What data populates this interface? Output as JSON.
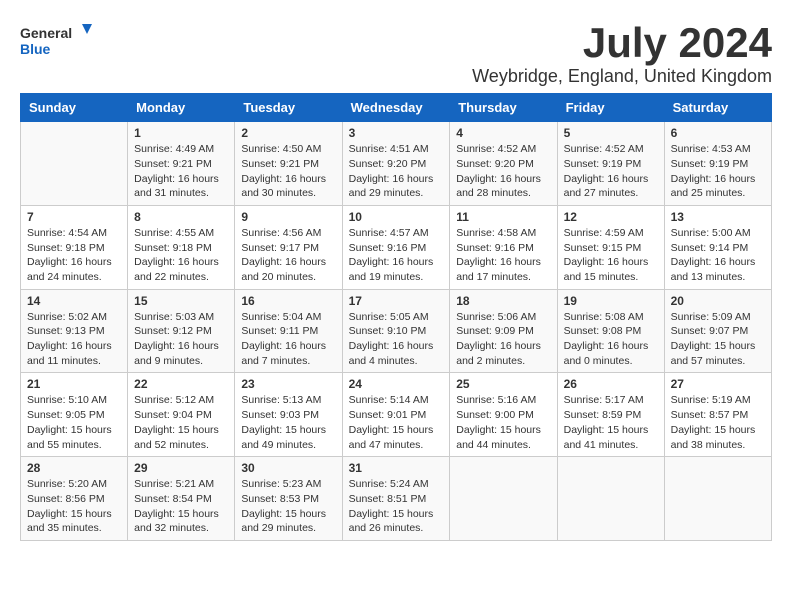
{
  "header": {
    "logo_general": "General",
    "logo_blue": "Blue",
    "title": "July 2024",
    "subtitle": "Weybridge, England, United Kingdom"
  },
  "columns": [
    "Sunday",
    "Monday",
    "Tuesday",
    "Wednesday",
    "Thursday",
    "Friday",
    "Saturday"
  ],
  "weeks": [
    {
      "days": [
        {
          "number": "",
          "info": ""
        },
        {
          "number": "1",
          "info": "Sunrise: 4:49 AM\nSunset: 9:21 PM\nDaylight: 16 hours\nand 31 minutes."
        },
        {
          "number": "2",
          "info": "Sunrise: 4:50 AM\nSunset: 9:21 PM\nDaylight: 16 hours\nand 30 minutes."
        },
        {
          "number": "3",
          "info": "Sunrise: 4:51 AM\nSunset: 9:20 PM\nDaylight: 16 hours\nand 29 minutes."
        },
        {
          "number": "4",
          "info": "Sunrise: 4:52 AM\nSunset: 9:20 PM\nDaylight: 16 hours\nand 28 minutes."
        },
        {
          "number": "5",
          "info": "Sunrise: 4:52 AM\nSunset: 9:19 PM\nDaylight: 16 hours\nand 27 minutes."
        },
        {
          "number": "6",
          "info": "Sunrise: 4:53 AM\nSunset: 9:19 PM\nDaylight: 16 hours\nand 25 minutes."
        }
      ]
    },
    {
      "days": [
        {
          "number": "7",
          "info": "Sunrise: 4:54 AM\nSunset: 9:18 PM\nDaylight: 16 hours\nand 24 minutes."
        },
        {
          "number": "8",
          "info": "Sunrise: 4:55 AM\nSunset: 9:18 PM\nDaylight: 16 hours\nand 22 minutes."
        },
        {
          "number": "9",
          "info": "Sunrise: 4:56 AM\nSunset: 9:17 PM\nDaylight: 16 hours\nand 20 minutes."
        },
        {
          "number": "10",
          "info": "Sunrise: 4:57 AM\nSunset: 9:16 PM\nDaylight: 16 hours\nand 19 minutes."
        },
        {
          "number": "11",
          "info": "Sunrise: 4:58 AM\nSunset: 9:16 PM\nDaylight: 16 hours\nand 17 minutes."
        },
        {
          "number": "12",
          "info": "Sunrise: 4:59 AM\nSunset: 9:15 PM\nDaylight: 16 hours\nand 15 minutes."
        },
        {
          "number": "13",
          "info": "Sunrise: 5:00 AM\nSunset: 9:14 PM\nDaylight: 16 hours\nand 13 minutes."
        }
      ]
    },
    {
      "days": [
        {
          "number": "14",
          "info": "Sunrise: 5:02 AM\nSunset: 9:13 PM\nDaylight: 16 hours\nand 11 minutes."
        },
        {
          "number": "15",
          "info": "Sunrise: 5:03 AM\nSunset: 9:12 PM\nDaylight: 16 hours\nand 9 minutes."
        },
        {
          "number": "16",
          "info": "Sunrise: 5:04 AM\nSunset: 9:11 PM\nDaylight: 16 hours\nand 7 minutes."
        },
        {
          "number": "17",
          "info": "Sunrise: 5:05 AM\nSunset: 9:10 PM\nDaylight: 16 hours\nand 4 minutes."
        },
        {
          "number": "18",
          "info": "Sunrise: 5:06 AM\nSunset: 9:09 PM\nDaylight: 16 hours\nand 2 minutes."
        },
        {
          "number": "19",
          "info": "Sunrise: 5:08 AM\nSunset: 9:08 PM\nDaylight: 16 hours\nand 0 minutes."
        },
        {
          "number": "20",
          "info": "Sunrise: 5:09 AM\nSunset: 9:07 PM\nDaylight: 15 hours\nand 57 minutes."
        }
      ]
    },
    {
      "days": [
        {
          "number": "21",
          "info": "Sunrise: 5:10 AM\nSunset: 9:05 PM\nDaylight: 15 hours\nand 55 minutes."
        },
        {
          "number": "22",
          "info": "Sunrise: 5:12 AM\nSunset: 9:04 PM\nDaylight: 15 hours\nand 52 minutes."
        },
        {
          "number": "23",
          "info": "Sunrise: 5:13 AM\nSunset: 9:03 PM\nDaylight: 15 hours\nand 49 minutes."
        },
        {
          "number": "24",
          "info": "Sunrise: 5:14 AM\nSunset: 9:01 PM\nDaylight: 15 hours\nand 47 minutes."
        },
        {
          "number": "25",
          "info": "Sunrise: 5:16 AM\nSunset: 9:00 PM\nDaylight: 15 hours\nand 44 minutes."
        },
        {
          "number": "26",
          "info": "Sunrise: 5:17 AM\nSunset: 8:59 PM\nDaylight: 15 hours\nand 41 minutes."
        },
        {
          "number": "27",
          "info": "Sunrise: 5:19 AM\nSunset: 8:57 PM\nDaylight: 15 hours\nand 38 minutes."
        }
      ]
    },
    {
      "days": [
        {
          "number": "28",
          "info": "Sunrise: 5:20 AM\nSunset: 8:56 PM\nDaylight: 15 hours\nand 35 minutes."
        },
        {
          "number": "29",
          "info": "Sunrise: 5:21 AM\nSunset: 8:54 PM\nDaylight: 15 hours\nand 32 minutes."
        },
        {
          "number": "30",
          "info": "Sunrise: 5:23 AM\nSunset: 8:53 PM\nDaylight: 15 hours\nand 29 minutes."
        },
        {
          "number": "31",
          "info": "Sunrise: 5:24 AM\nSunset: 8:51 PM\nDaylight: 15 hours\nand 26 minutes."
        },
        {
          "number": "",
          "info": ""
        },
        {
          "number": "",
          "info": ""
        },
        {
          "number": "",
          "info": ""
        }
      ]
    }
  ]
}
